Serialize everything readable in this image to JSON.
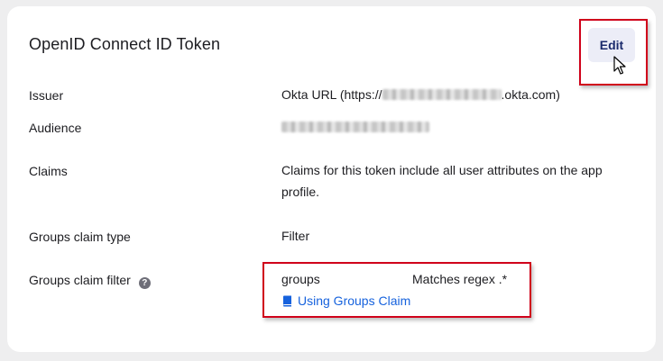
{
  "card": {
    "title": "OpenID Connect ID Token",
    "edit_label": "Edit"
  },
  "rows": {
    "issuer": {
      "label": "Issuer",
      "value_prefix": "Okta URL (https://",
      "value_suffix": ".okta.com)"
    },
    "audience": {
      "label": "Audience"
    },
    "claims": {
      "label": "Claims",
      "line1": "Claims for this token include all user attributes on the app",
      "line2": "profile."
    },
    "groups_claim_type": {
      "label": "Groups claim type",
      "value": "Filter"
    },
    "groups_claim_filter": {
      "label": "Groups claim filter",
      "help_glyph": "?",
      "name": "groups",
      "operator": "Matches regex .*",
      "link_label": "Using Groups Claim"
    }
  },
  "colors": {
    "accent": "#1662dd",
    "highlight": "#d0021b",
    "button_bg": "#ecedf7",
    "button_text": "#1a2a6c"
  },
  "icons": [
    "arrow-cursor-icon",
    "help-icon",
    "book-icon"
  ]
}
